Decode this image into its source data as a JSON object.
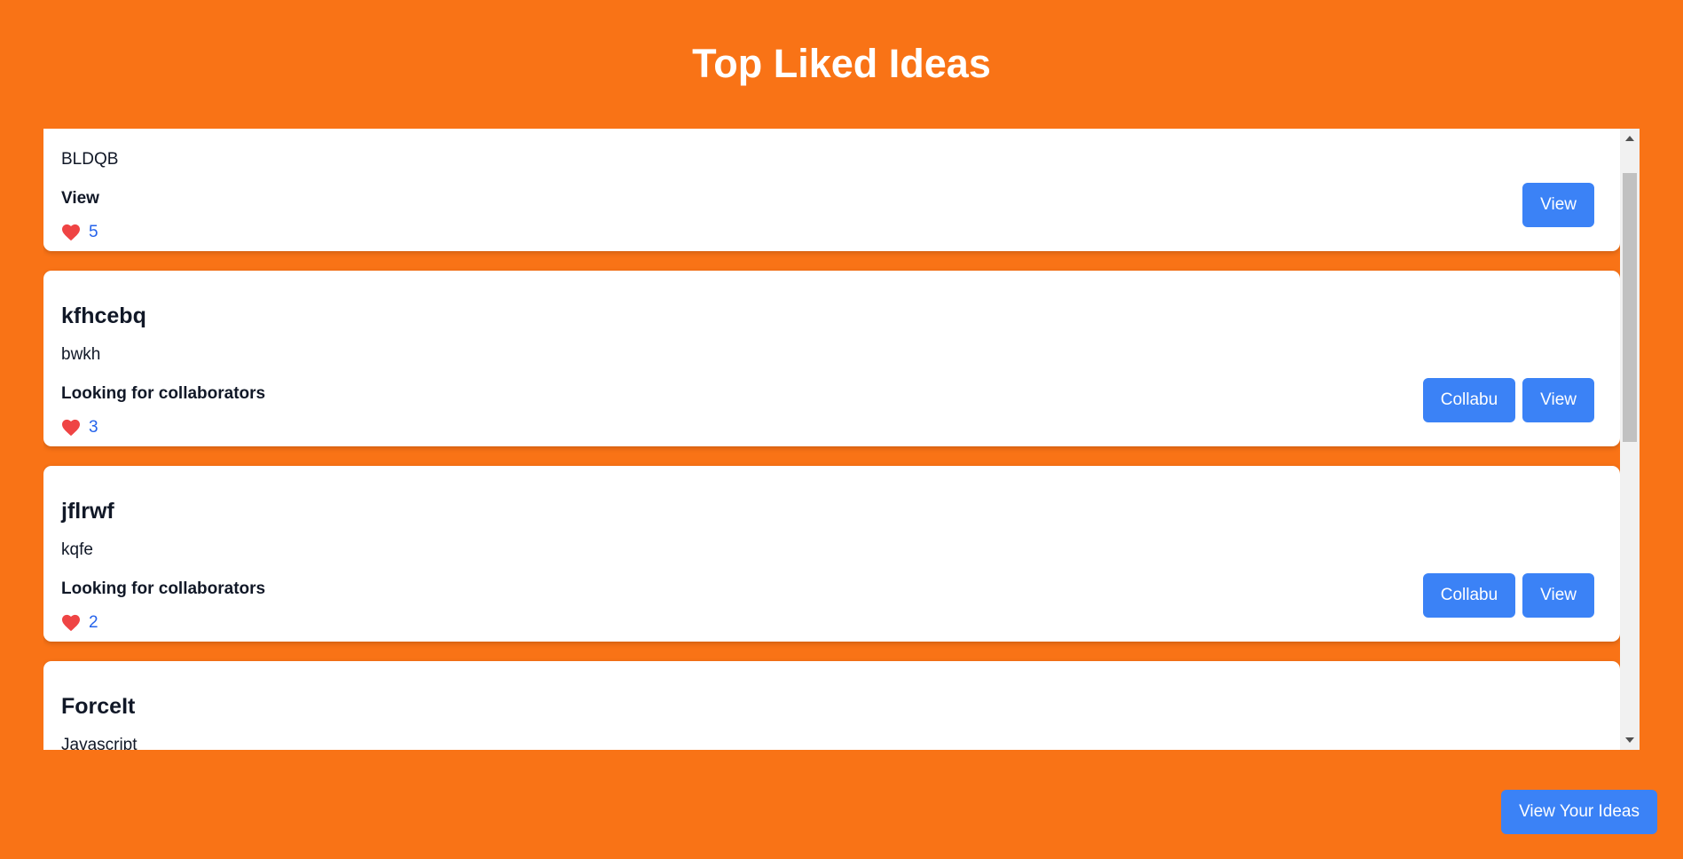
{
  "header": {
    "title": "Top Liked Ideas"
  },
  "ideas": [
    {
      "title": "",
      "description": "BLDQB",
      "status": "View",
      "likes": "5",
      "buttons": [
        "View"
      ]
    },
    {
      "title": "kfhcebq",
      "description": "bwkh",
      "status": "Looking for collaborators",
      "likes": "3",
      "buttons": [
        "Collabu",
        "View"
      ]
    },
    {
      "title": "jflrwf",
      "description": "kqfe",
      "status": "Looking for collaborators",
      "likes": "2",
      "buttons": [
        "Collabu",
        "View"
      ]
    },
    {
      "title": "ForceIt",
      "description": "Javascript",
      "status": "",
      "likes": "",
      "buttons": []
    }
  ],
  "footer": {
    "view_your_ideas_label": "View Your Ideas"
  },
  "colors": {
    "background": "#f97316",
    "button": "#3b82f6",
    "heart": "#ef4444",
    "like_count": "#2563eb"
  },
  "icons": {
    "like": "heart-icon"
  }
}
